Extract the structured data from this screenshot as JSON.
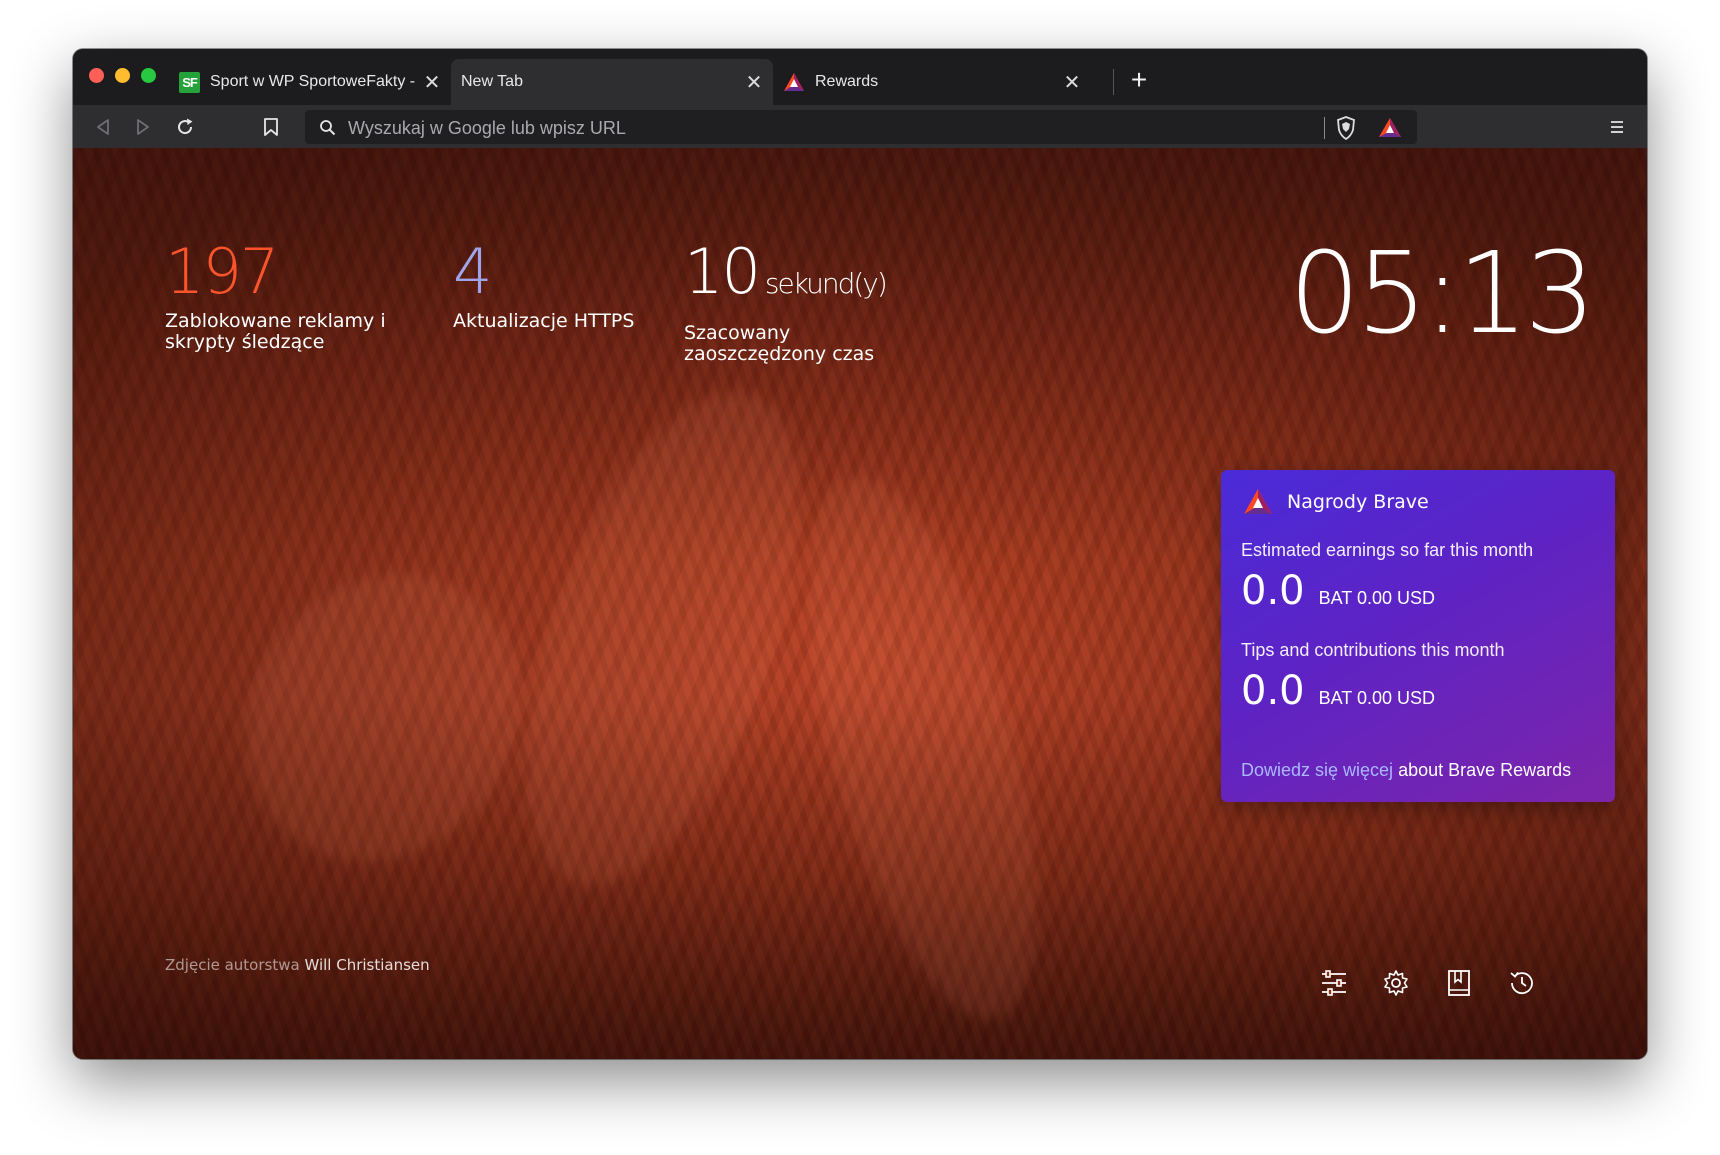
{
  "tabs": [
    {
      "title": "Sport w WP SportoweFakty - wiadomości sportowe",
      "favicon": "SF",
      "close": "✕"
    },
    {
      "title": "New Tab",
      "close": "✕"
    },
    {
      "title": "Rewards",
      "favicon": "bat-triangle-icon",
      "close": "✕"
    }
  ],
  "new_tab_label": "+",
  "address_bar": {
    "placeholder": "Wyszukaj w Google lub wpisz URL"
  },
  "stats": {
    "trackers": {
      "value": "197",
      "label": "Zablokowane reklamy i skrypty śledzące",
      "color": "#fb542b"
    },
    "https": {
      "value": "4",
      "label": "Aktualizacje HTTPS",
      "color": "#a0a5eb"
    },
    "time": {
      "value": "10",
      "unit": "sekund(y)",
      "label": "Szacowany zaoszczędzony czas",
      "color": "#ffffff"
    }
  },
  "clock": "05:13",
  "rewards": {
    "title": "Nagrody Brave",
    "earnings_label": "Estimated earnings so far this month",
    "earnings_value": "0.0",
    "earnings_unit": "BAT 0.00 USD",
    "tips_label": "Tips and contributions this month",
    "tips_value": "0.0",
    "tips_unit": "BAT 0.00 USD",
    "learn_more_link": "Dowiedz się więcej",
    "learn_more_suffix": "about Brave Rewards"
  },
  "photo_credit": {
    "prefix": "Zdjęcie autorstwa",
    "author": "Will Christiansen"
  },
  "bottom_icons": [
    "customize-icon",
    "settings-icon",
    "bookmarks-icon",
    "history-icon"
  ],
  "colors": {
    "window_bg": "#1c1c1e",
    "toolbar_bg": "#2e2e31",
    "rewards_gradient_start": "#4a2bd8",
    "rewards_gradient_end": "#7d25a9",
    "accent_orange": "#fb542b"
  }
}
